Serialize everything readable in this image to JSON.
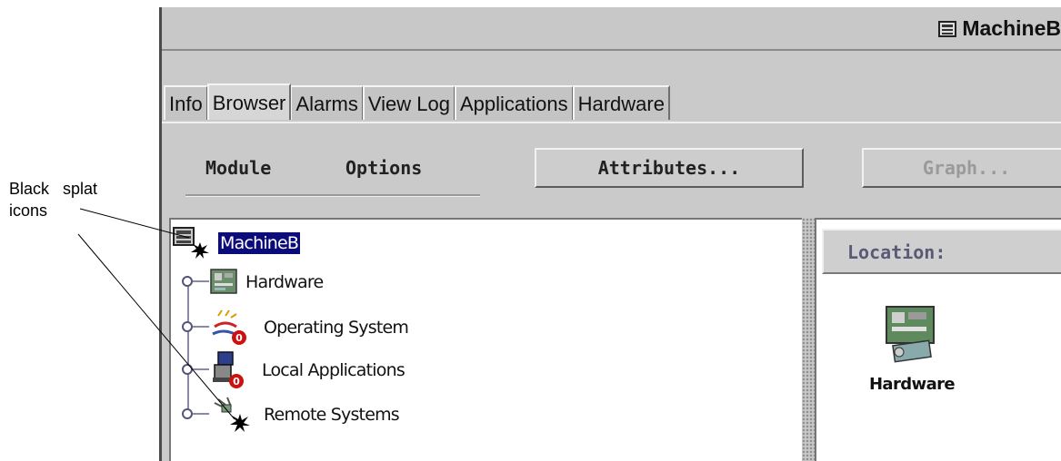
{
  "annotation": {
    "line1": "Black   splat",
    "line2": "icons"
  },
  "window": {
    "title": "MachineB"
  },
  "tabs": [
    {
      "label": "Info",
      "active": false
    },
    {
      "label": "Browser",
      "active": true
    },
    {
      "label": "Alarms",
      "active": false
    },
    {
      "label": "View Log",
      "active": false
    },
    {
      "label": "Applications",
      "active": false
    },
    {
      "label": "Hardware",
      "active": false
    }
  ],
  "toolbar": {
    "menu_module": "Module",
    "menu_options": "Options",
    "attributes_button": "Attributes...",
    "graph_button": "Graph..."
  },
  "tree": {
    "root": {
      "label": "MachineB",
      "icon": "machine-splat-icon",
      "selected": true
    },
    "children": [
      {
        "label": "Hardware",
        "icon": "hardware-board-icon"
      },
      {
        "label": "Operating System",
        "icon": "operating-system-alarm-icon"
      },
      {
        "label": "Local Applications",
        "icon": "local-applications-alarm-icon"
      },
      {
        "label": "Remote Systems",
        "icon": "remote-systems-splat-icon"
      }
    ]
  },
  "details": {
    "location_label": "Location:",
    "item_label": "Hardware",
    "item_icon": "hardware-board-icon"
  },
  "colors": {
    "selection": "#0b0b7a",
    "window_bg": "#cacaca",
    "alarm_red": "#cc1111"
  }
}
